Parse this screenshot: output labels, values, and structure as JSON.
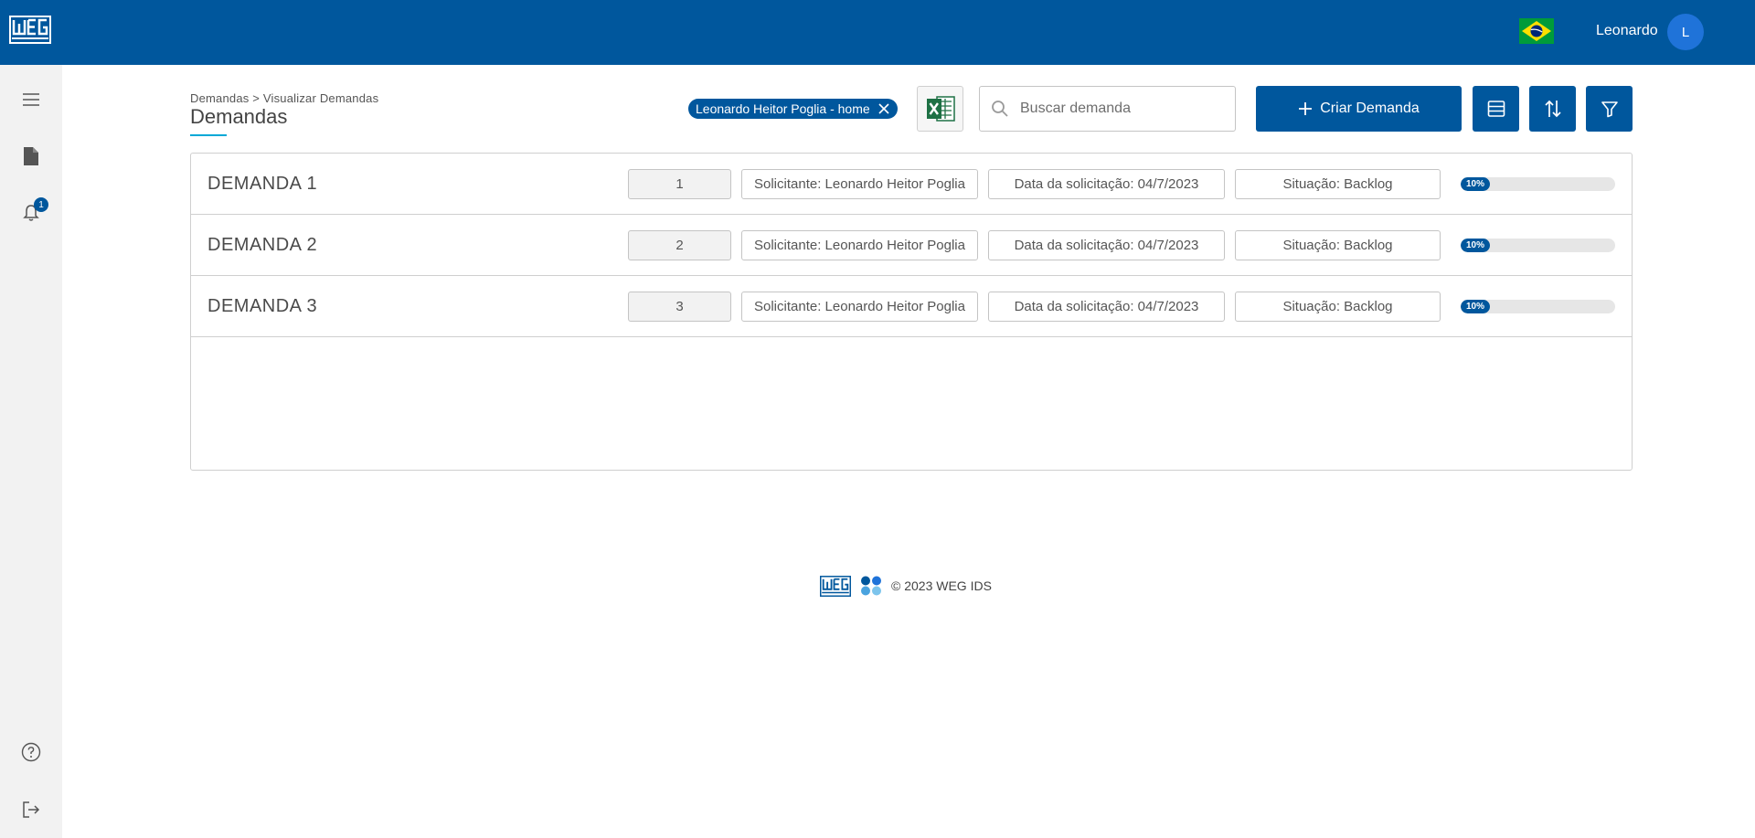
{
  "header": {
    "logo_text": "WEG",
    "user_name": "Leonardo",
    "avatar_initial": "L",
    "flag": "brazil-flag-icon"
  },
  "sidebar": {
    "items": [
      {
        "icon": "menu-icon"
      },
      {
        "icon": "document-icon"
      },
      {
        "icon": "bell-icon",
        "badge": "1"
      },
      {
        "icon": "help-icon"
      },
      {
        "icon": "logout-icon"
      }
    ]
  },
  "page": {
    "breadcrumb": "Demandas > Visualizar Demandas",
    "title": "Demandas"
  },
  "toolbar": {
    "filter_chip_label": "Leonardo Heitor Poglia - home",
    "search_placeholder": "Buscar demanda",
    "create_label": "Criar Demanda"
  },
  "demandas": [
    {
      "title": "DEMANDA 1",
      "id": "1",
      "solicitante": "Solicitante: Leonardo Heitor Poglia",
      "data": "Data da solicitação: 04/7/2023",
      "situacao": "Situação: Backlog",
      "progress_label": "10%",
      "progress": 0.1
    },
    {
      "title": "DEMANDA 2",
      "id": "2",
      "solicitante": "Solicitante: Leonardo Heitor Poglia",
      "data": "Data da solicitação: 04/7/2023",
      "situacao": "Situação: Backlog",
      "progress_label": "10%",
      "progress": 0.1
    },
    {
      "title": "DEMANDA 3",
      "id": "3",
      "solicitante": "Solicitante: Leonardo Heitor Poglia",
      "data": "Data da solicitação: 04/7/2023",
      "situacao": "Situação: Backlog",
      "progress_label": "10%",
      "progress": 0.1
    }
  ],
  "footer": {
    "copyright": "© 2023 WEG IDS"
  },
  "colors": {
    "brand": "#00579d",
    "accent": "#00a8d6"
  }
}
